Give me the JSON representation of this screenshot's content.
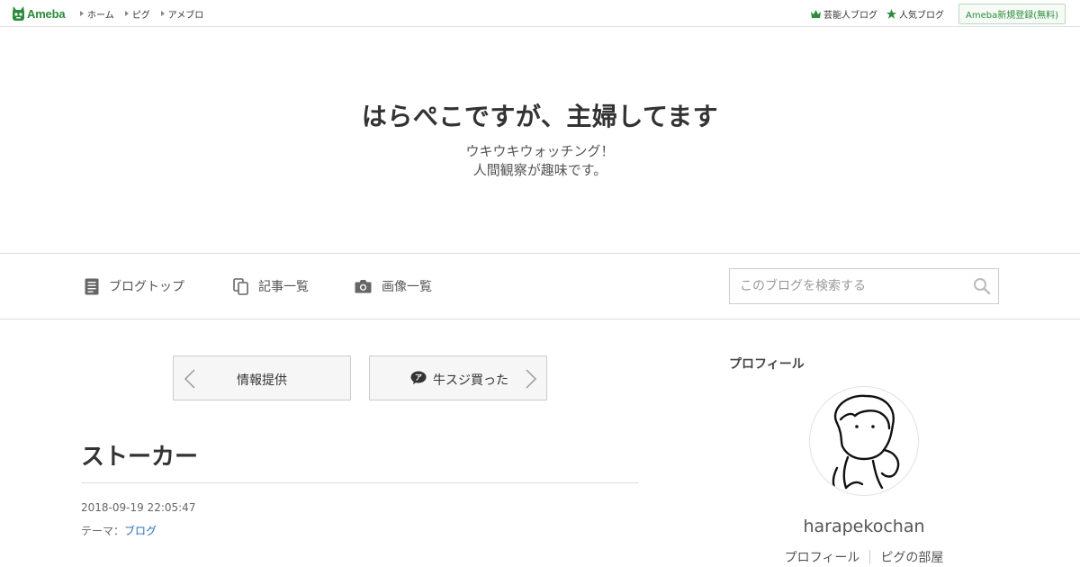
{
  "global_header": {
    "logo_text": "Ameba",
    "nav": [
      "ホーム",
      "ピグ",
      "アメブロ"
    ],
    "celebrity_blog": "芸能人ブログ",
    "popular_blog": "人気ブログ",
    "signup": "Ameba新規登録(無料)"
  },
  "blog": {
    "title": "はらぺこですが、主婦してます",
    "description_line1": "ウキウキウォッチング！",
    "description_line2": "人間観察が趣味です。"
  },
  "blog_nav": {
    "top": "ブログトップ",
    "articles": "記事一覧",
    "images": "画像一覧",
    "search_placeholder": "このブログを検索する"
  },
  "pager": {
    "prev_label": "情報提供",
    "next_label": "牛スジ買った"
  },
  "article": {
    "title": "ストーカー",
    "datetime": "2018-09-19 22:05:47",
    "theme_label": "テーマ：",
    "theme_value": "ブログ"
  },
  "sidebar": {
    "heading": "プロフィール",
    "username": "harapekochan",
    "links": [
      "プロフィール",
      "ピグの部屋"
    ]
  },
  "colors": {
    "brand_green": "#2d8c3c",
    "link_blue": "#2a6fb5"
  },
  "icons": {
    "logo": "ameba-logo-icon",
    "crown": "crown-icon",
    "star": "star-icon",
    "blog_top": "document-icon",
    "articles": "copy-icon",
    "images": "camera-icon",
    "search": "search-icon",
    "prev": "chevron-left-icon",
    "next": "chevron-right-icon",
    "badge": "ameba-badge-icon"
  }
}
